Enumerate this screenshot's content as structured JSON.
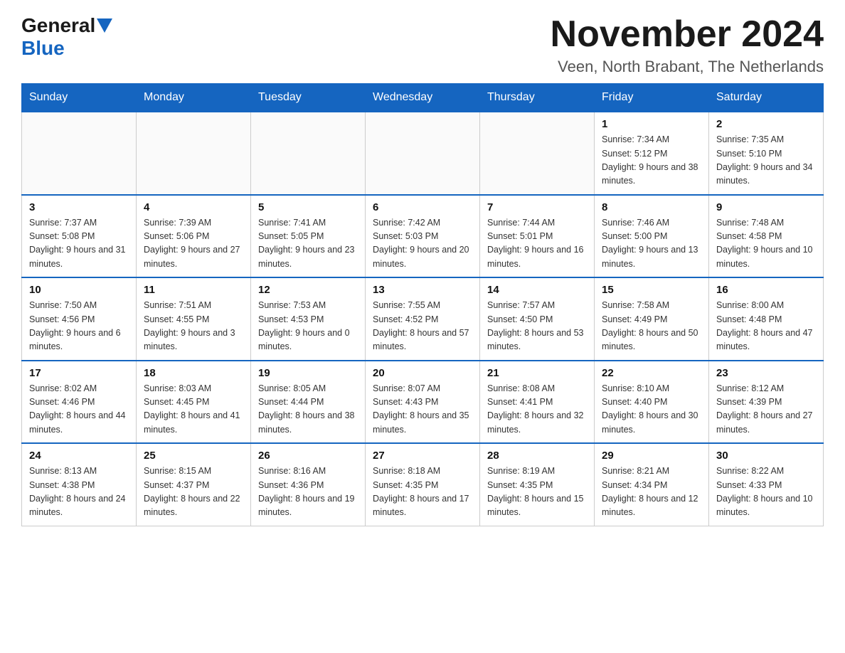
{
  "header": {
    "logo_general": "General",
    "logo_blue": "Blue",
    "month_title": "November 2024",
    "location": "Veen, North Brabant, The Netherlands"
  },
  "days_of_week": [
    "Sunday",
    "Monday",
    "Tuesday",
    "Wednesday",
    "Thursday",
    "Friday",
    "Saturday"
  ],
  "weeks": [
    {
      "days": [
        {
          "number": "",
          "info": ""
        },
        {
          "number": "",
          "info": ""
        },
        {
          "number": "",
          "info": ""
        },
        {
          "number": "",
          "info": ""
        },
        {
          "number": "",
          "info": ""
        },
        {
          "number": "1",
          "info": "Sunrise: 7:34 AM\nSunset: 5:12 PM\nDaylight: 9 hours and 38 minutes."
        },
        {
          "number": "2",
          "info": "Sunrise: 7:35 AM\nSunset: 5:10 PM\nDaylight: 9 hours and 34 minutes."
        }
      ]
    },
    {
      "days": [
        {
          "number": "3",
          "info": "Sunrise: 7:37 AM\nSunset: 5:08 PM\nDaylight: 9 hours and 31 minutes."
        },
        {
          "number": "4",
          "info": "Sunrise: 7:39 AM\nSunset: 5:06 PM\nDaylight: 9 hours and 27 minutes."
        },
        {
          "number": "5",
          "info": "Sunrise: 7:41 AM\nSunset: 5:05 PM\nDaylight: 9 hours and 23 minutes."
        },
        {
          "number": "6",
          "info": "Sunrise: 7:42 AM\nSunset: 5:03 PM\nDaylight: 9 hours and 20 minutes."
        },
        {
          "number": "7",
          "info": "Sunrise: 7:44 AM\nSunset: 5:01 PM\nDaylight: 9 hours and 16 minutes."
        },
        {
          "number": "8",
          "info": "Sunrise: 7:46 AM\nSunset: 5:00 PM\nDaylight: 9 hours and 13 minutes."
        },
        {
          "number": "9",
          "info": "Sunrise: 7:48 AM\nSunset: 4:58 PM\nDaylight: 9 hours and 10 minutes."
        }
      ]
    },
    {
      "days": [
        {
          "number": "10",
          "info": "Sunrise: 7:50 AM\nSunset: 4:56 PM\nDaylight: 9 hours and 6 minutes."
        },
        {
          "number": "11",
          "info": "Sunrise: 7:51 AM\nSunset: 4:55 PM\nDaylight: 9 hours and 3 minutes."
        },
        {
          "number": "12",
          "info": "Sunrise: 7:53 AM\nSunset: 4:53 PM\nDaylight: 9 hours and 0 minutes."
        },
        {
          "number": "13",
          "info": "Sunrise: 7:55 AM\nSunset: 4:52 PM\nDaylight: 8 hours and 57 minutes."
        },
        {
          "number": "14",
          "info": "Sunrise: 7:57 AM\nSunset: 4:50 PM\nDaylight: 8 hours and 53 minutes."
        },
        {
          "number": "15",
          "info": "Sunrise: 7:58 AM\nSunset: 4:49 PM\nDaylight: 8 hours and 50 minutes."
        },
        {
          "number": "16",
          "info": "Sunrise: 8:00 AM\nSunset: 4:48 PM\nDaylight: 8 hours and 47 minutes."
        }
      ]
    },
    {
      "days": [
        {
          "number": "17",
          "info": "Sunrise: 8:02 AM\nSunset: 4:46 PM\nDaylight: 8 hours and 44 minutes."
        },
        {
          "number": "18",
          "info": "Sunrise: 8:03 AM\nSunset: 4:45 PM\nDaylight: 8 hours and 41 minutes."
        },
        {
          "number": "19",
          "info": "Sunrise: 8:05 AM\nSunset: 4:44 PM\nDaylight: 8 hours and 38 minutes."
        },
        {
          "number": "20",
          "info": "Sunrise: 8:07 AM\nSunset: 4:43 PM\nDaylight: 8 hours and 35 minutes."
        },
        {
          "number": "21",
          "info": "Sunrise: 8:08 AM\nSunset: 4:41 PM\nDaylight: 8 hours and 32 minutes."
        },
        {
          "number": "22",
          "info": "Sunrise: 8:10 AM\nSunset: 4:40 PM\nDaylight: 8 hours and 30 minutes."
        },
        {
          "number": "23",
          "info": "Sunrise: 8:12 AM\nSunset: 4:39 PM\nDaylight: 8 hours and 27 minutes."
        }
      ]
    },
    {
      "days": [
        {
          "number": "24",
          "info": "Sunrise: 8:13 AM\nSunset: 4:38 PM\nDaylight: 8 hours and 24 minutes."
        },
        {
          "number": "25",
          "info": "Sunrise: 8:15 AM\nSunset: 4:37 PM\nDaylight: 8 hours and 22 minutes."
        },
        {
          "number": "26",
          "info": "Sunrise: 8:16 AM\nSunset: 4:36 PM\nDaylight: 8 hours and 19 minutes."
        },
        {
          "number": "27",
          "info": "Sunrise: 8:18 AM\nSunset: 4:35 PM\nDaylight: 8 hours and 17 minutes."
        },
        {
          "number": "28",
          "info": "Sunrise: 8:19 AM\nSunset: 4:35 PM\nDaylight: 8 hours and 15 minutes."
        },
        {
          "number": "29",
          "info": "Sunrise: 8:21 AM\nSunset: 4:34 PM\nDaylight: 8 hours and 12 minutes."
        },
        {
          "number": "30",
          "info": "Sunrise: 8:22 AM\nSunset: 4:33 PM\nDaylight: 8 hours and 10 minutes."
        }
      ]
    }
  ]
}
